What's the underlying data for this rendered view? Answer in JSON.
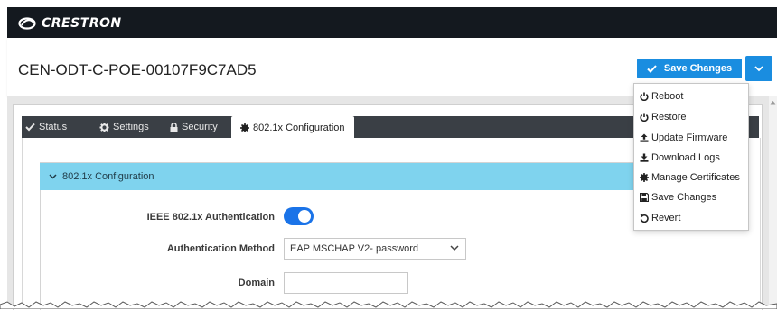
{
  "brand": {
    "logo_text": "CRESTRON"
  },
  "header": {
    "device_name": "CEN-ODT-C-POE-00107F9C7AD5",
    "save_button_label": "Save Changes"
  },
  "actions_menu": {
    "items": [
      {
        "label": "Reboot",
        "icon": "power-icon"
      },
      {
        "label": "Restore",
        "icon": "power-icon"
      },
      {
        "label": "Update Firmware",
        "icon": "upload-icon"
      },
      {
        "label": "Download Logs",
        "icon": "download-icon"
      },
      {
        "label": "Manage Certificates",
        "icon": "certificate-icon"
      },
      {
        "label": "Save Changes",
        "icon": "floppy-disk-icon"
      },
      {
        "label": "Revert",
        "icon": "undo-icon"
      }
    ]
  },
  "tabs": [
    {
      "label": "Status",
      "icon": "check-icon"
    },
    {
      "label": "Settings",
      "icon": "gear-icon"
    },
    {
      "label": "Security",
      "icon": "lock-icon"
    },
    {
      "label": "802.1x Configuration",
      "icon": "certificate-icon",
      "active": true
    }
  ],
  "section": {
    "title": "802.1x Configuration",
    "fields": {
      "auth_label": "IEEE 802.1x Authentication",
      "auth_enabled": true,
      "method_label": "Authentication Method",
      "method_value": "EAP MSCHAP V2- password",
      "domain_label": "Domain",
      "domain_value": ""
    }
  },
  "colors": {
    "top_bar": "#14191f",
    "primary_button": "#1a8de0",
    "section_header": "#7fd3ee",
    "toggle_on": "#1a73e8"
  }
}
